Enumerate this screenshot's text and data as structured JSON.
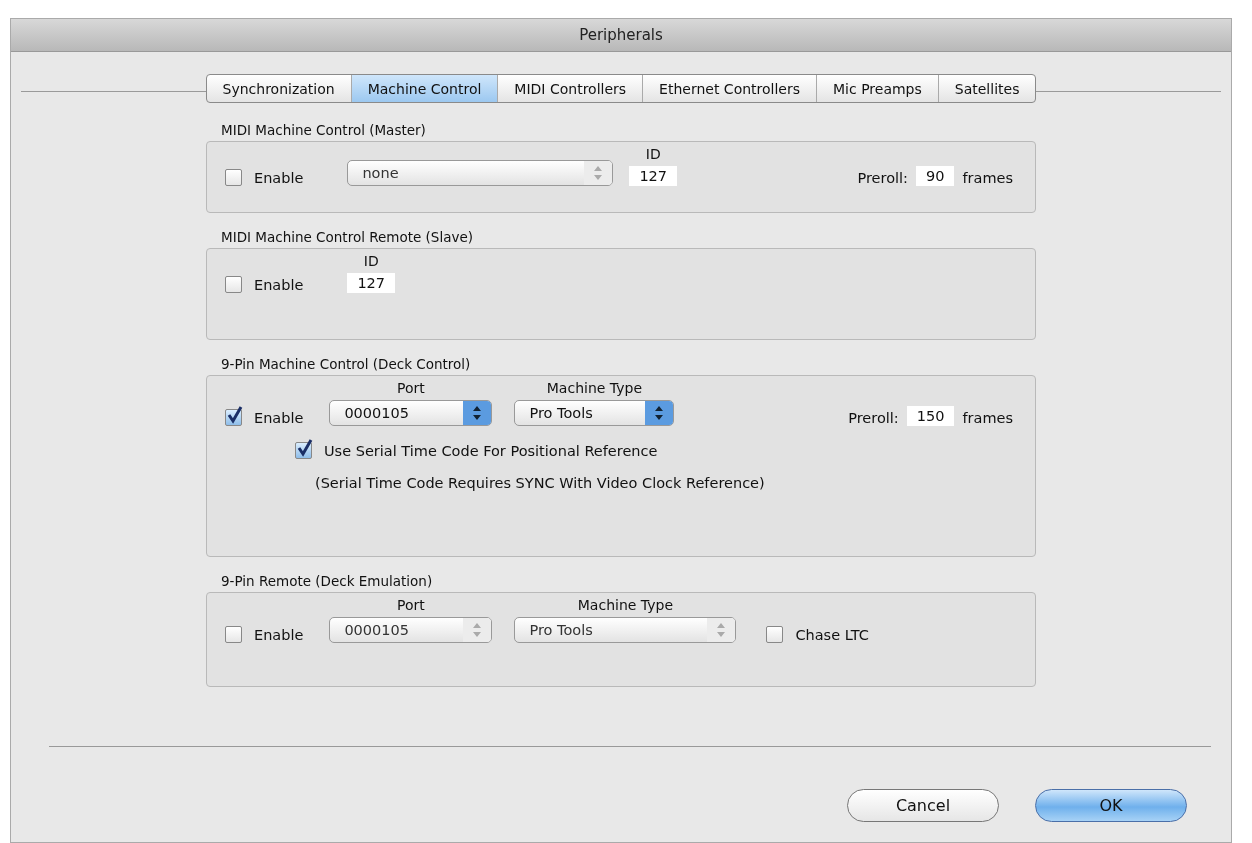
{
  "window": {
    "title": "Peripherals"
  },
  "tabs": [
    {
      "label": "Synchronization",
      "selected": false
    },
    {
      "label": "Machine Control",
      "selected": true
    },
    {
      "label": "MIDI Controllers",
      "selected": false
    },
    {
      "label": "Ethernet Controllers",
      "selected": false
    },
    {
      "label": "Mic Preamps",
      "selected": false
    },
    {
      "label": "Satellites",
      "selected": false
    }
  ],
  "sections": [
    {
      "title": "MIDI Machine Control (Master)",
      "rows": [
        {
          "controls": [
            {
              "kind": "checkbox",
              "label": "Enable",
              "checked": false
            },
            {
              "kind": "select",
              "value": "none",
              "disabled": true
            },
            {
              "kind": "field",
              "header": "ID",
              "value": "127"
            },
            {
              "kind": "spacer"
            },
            {
              "kind": "label",
              "text": "Preroll:"
            },
            {
              "kind": "field",
              "value": "90"
            },
            {
              "kind": "label",
              "text": "frames"
            }
          ]
        }
      ]
    },
    {
      "title": "MIDI Machine Control Remote (Slave)",
      "rows": [
        {
          "controls": [
            {
              "kind": "checkbox",
              "label": "Enable",
              "checked": false
            },
            {
              "kind": "field",
              "header": "ID",
              "value": "127"
            }
          ]
        }
      ]
    },
    {
      "title": "9-Pin Machine Control (Deck Control)",
      "rows": [
        {
          "controls": [
            {
              "kind": "checkbox",
              "label": "Enable",
              "checked": true
            },
            {
              "kind": "select",
              "header": "Port",
              "value": "0000105",
              "disabled": false
            },
            {
              "kind": "select",
              "header": "Machine Type",
              "value": "Pro Tools",
              "disabled": false
            },
            {
              "kind": "spacer"
            },
            {
              "kind": "label",
              "text": "Preroll:"
            },
            {
              "kind": "field",
              "value": "150"
            },
            {
              "kind": "label",
              "text": "frames"
            }
          ]
        },
        {
          "indent": true,
          "controls": [
            {
              "kind": "checkbox",
              "label": "Use Serial Time Code For Positional Reference",
              "checked": true
            }
          ]
        },
        {
          "indent": true,
          "controls": [
            {
              "kind": "note",
              "text": "(Serial Time Code Requires SYNC With Video Clock Reference)"
            }
          ]
        }
      ]
    },
    {
      "title": "9-Pin Remote (Deck Emulation)",
      "rows": [
        {
          "controls": [
            {
              "kind": "checkbox",
              "label": "Enable",
              "checked": false
            },
            {
              "kind": "select",
              "header": "Port",
              "value": "0000105",
              "disabled": true
            },
            {
              "kind": "select",
              "header": "Machine Type",
              "value": "Pro Tools",
              "disabled": true
            },
            {
              "kind": "checkbox",
              "label": "Chase LTC",
              "checked": false
            }
          ]
        }
      ]
    }
  ],
  "buttons": [
    {
      "label": "Cancel",
      "default": false
    },
    {
      "label": "OK",
      "default": true
    }
  ]
}
